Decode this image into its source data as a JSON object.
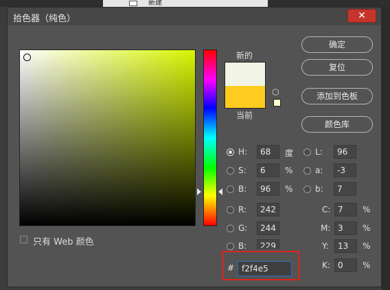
{
  "background": {
    "menu_label": "新建"
  },
  "dialog": {
    "title": "拾色器（纯色）",
    "close_glyph": "✕",
    "only_web_colors": "只有 Web 颜色",
    "new_label": "新的",
    "current_label": "当前",
    "new_color": "#f2f4e5",
    "current_color": "#fdcc1f",
    "websafe_color": "#ffffcc",
    "hue_base_color": "#d6f500",
    "buttons": {
      "ok": "确定",
      "reset": "复位",
      "add_swatch": "添加到色板",
      "libraries": "颜色库"
    },
    "hsb": [
      {
        "label": "H:",
        "value": "68",
        "unit": "度",
        "selected": true
      },
      {
        "label": "S:",
        "value": "6",
        "unit": "%",
        "selected": false
      },
      {
        "label": "B:",
        "value": "96",
        "unit": "%",
        "selected": false
      }
    ],
    "rgb": [
      {
        "label": "R:",
        "value": "242"
      },
      {
        "label": "G:",
        "value": "244"
      },
      {
        "label": "B:",
        "value": "229"
      }
    ],
    "lab": [
      {
        "label": "L:",
        "value": "96"
      },
      {
        "label": "a:",
        "value": "-3"
      },
      {
        "label": "b:",
        "value": "7"
      }
    ],
    "cmyk": [
      {
        "label": "C:",
        "value": "7",
        "unit": "%"
      },
      {
        "label": "M:",
        "value": "3",
        "unit": "%"
      },
      {
        "label": "Y:",
        "value": "13",
        "unit": "%"
      },
      {
        "label": "K:",
        "value": "0",
        "unit": "%"
      }
    ],
    "hex_label": "#",
    "hex_value": "f2f4e5"
  }
}
